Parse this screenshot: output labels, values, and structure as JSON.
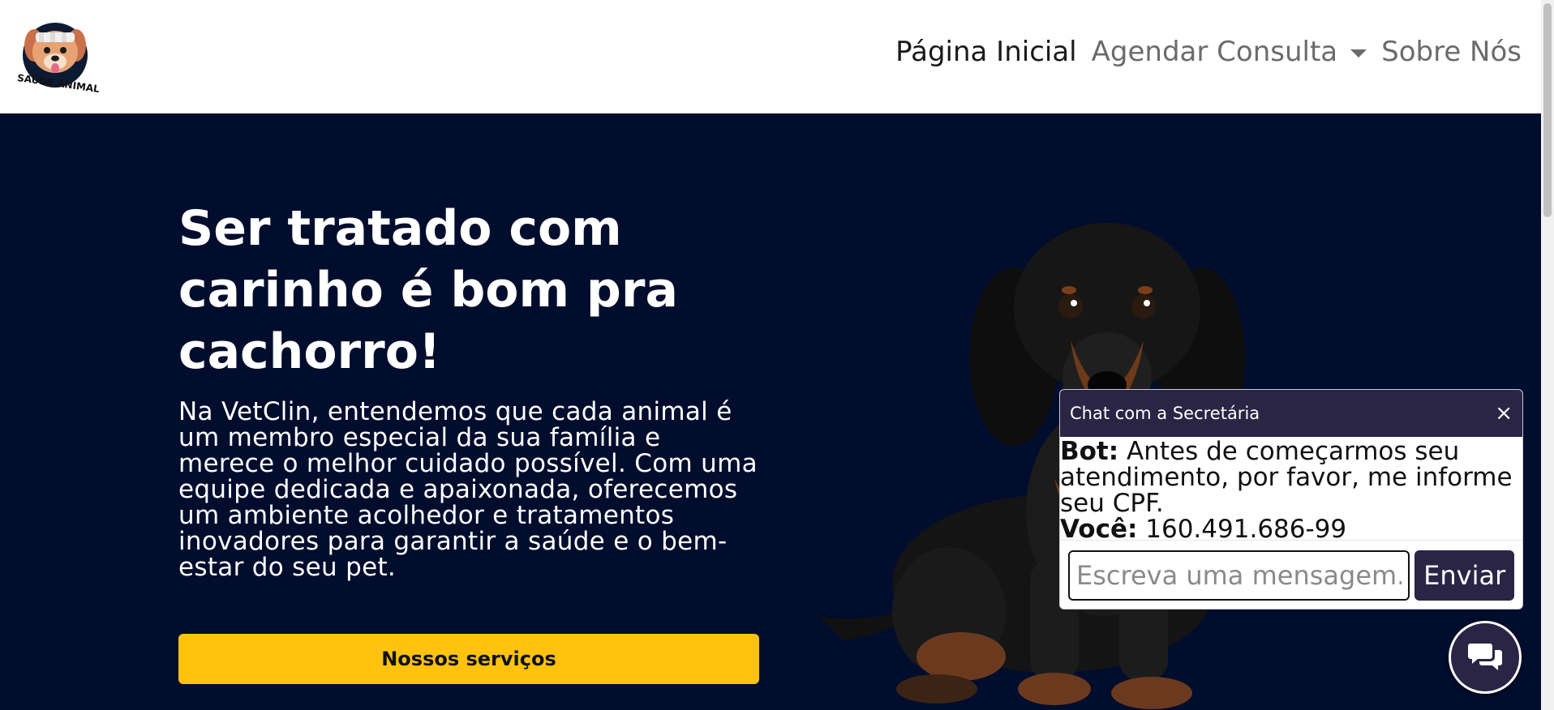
{
  "colors": {
    "hero_bg": "#000d2d",
    "cta": "#fec20f",
    "chat_accent": "#2a2445",
    "nav_text": "#6b6b6b",
    "nav_active": "#1a1a1a"
  },
  "logo": {
    "text": "SAÚDE ANIMAL",
    "icon": "dog-with-bandage-logo"
  },
  "nav": {
    "home": "Página Inicial",
    "schedule": "Agendar Consulta",
    "about": "Sobre Nós"
  },
  "hero": {
    "title": "Ser tratado com carinho é bom pra cachorro!",
    "text": "Na VetClin, entendemos que cada animal é um membro especial da sua família e merece o melhor cuidado possível. Com uma equipe dedicada e apaixonada, oferecemos um ambiente acolhedor e tratamentos inovadores para garantir a saúde e o bem-estar do seu pet.",
    "cta": "Nossos serviços"
  },
  "chat": {
    "title": "Chat com a Secretária",
    "close": "×",
    "messages": [
      {
        "sender": "Bot:",
        "text": "Antes de começarmos seu atendimento, por favor, me informe seu CPF."
      },
      {
        "sender": "Você:",
        "text": "160.491.686-99"
      }
    ],
    "input_placeholder": "Escreva uma mensagem...",
    "send": "Enviar"
  },
  "chat_fab": {
    "icon": "chat-bubbles-icon"
  }
}
